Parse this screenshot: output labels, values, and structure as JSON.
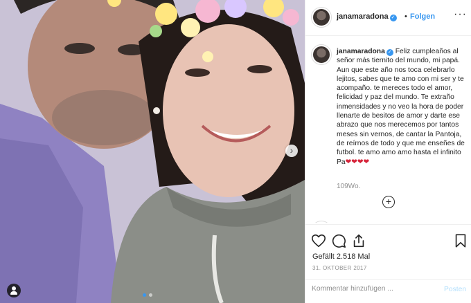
{
  "post": {
    "username": "janamaradona",
    "verified_mark": "✓",
    "follow_separator": "•",
    "follow_label": "Folgen",
    "more_label": "···",
    "caption_username": "janamaradona",
    "caption_text": "Feliz cumpleaños al señor más tiernito del mundo, mi papá. Aun que este año nos toca celebrarlo lejitos, sabes que te amo con mi ser y te acompaño. te mereces todo el amor, felicidad y paz del mundo. Te extraño inmensidades y no veo la hora de poder llenarte de besitos de amor y darte ese abrazo que nos merecemos por tantos meses sin vernos, de cantar la Pantoja, de reírnos de todo y que me enseñes de futbol. te amo amo amo hasta el infinito Pa",
    "caption_emoji": "❤❤❤❤",
    "time_ago": "109Wo.",
    "load_more_label": "+",
    "likes_text": "Gefällt 2.518 Mal",
    "date_text": "31. OKTOBER 2017",
    "comment_placeholder": "Kommentar hinzufügen ...",
    "post_button": "Posten",
    "next_arrow": "›"
  },
  "icons": [
    "like-icon",
    "comment-icon",
    "share-icon",
    "save-icon",
    "tag-people-icon",
    "chevron-right-icon",
    "add-circle-icon",
    "verified-icon"
  ],
  "colors": {
    "link_blue": "#3897f0",
    "muted": "#8e8e8e",
    "border": "#efefef",
    "post_disabled": "#b2dffc"
  },
  "carousel": {
    "current": 1,
    "count": 2
  }
}
